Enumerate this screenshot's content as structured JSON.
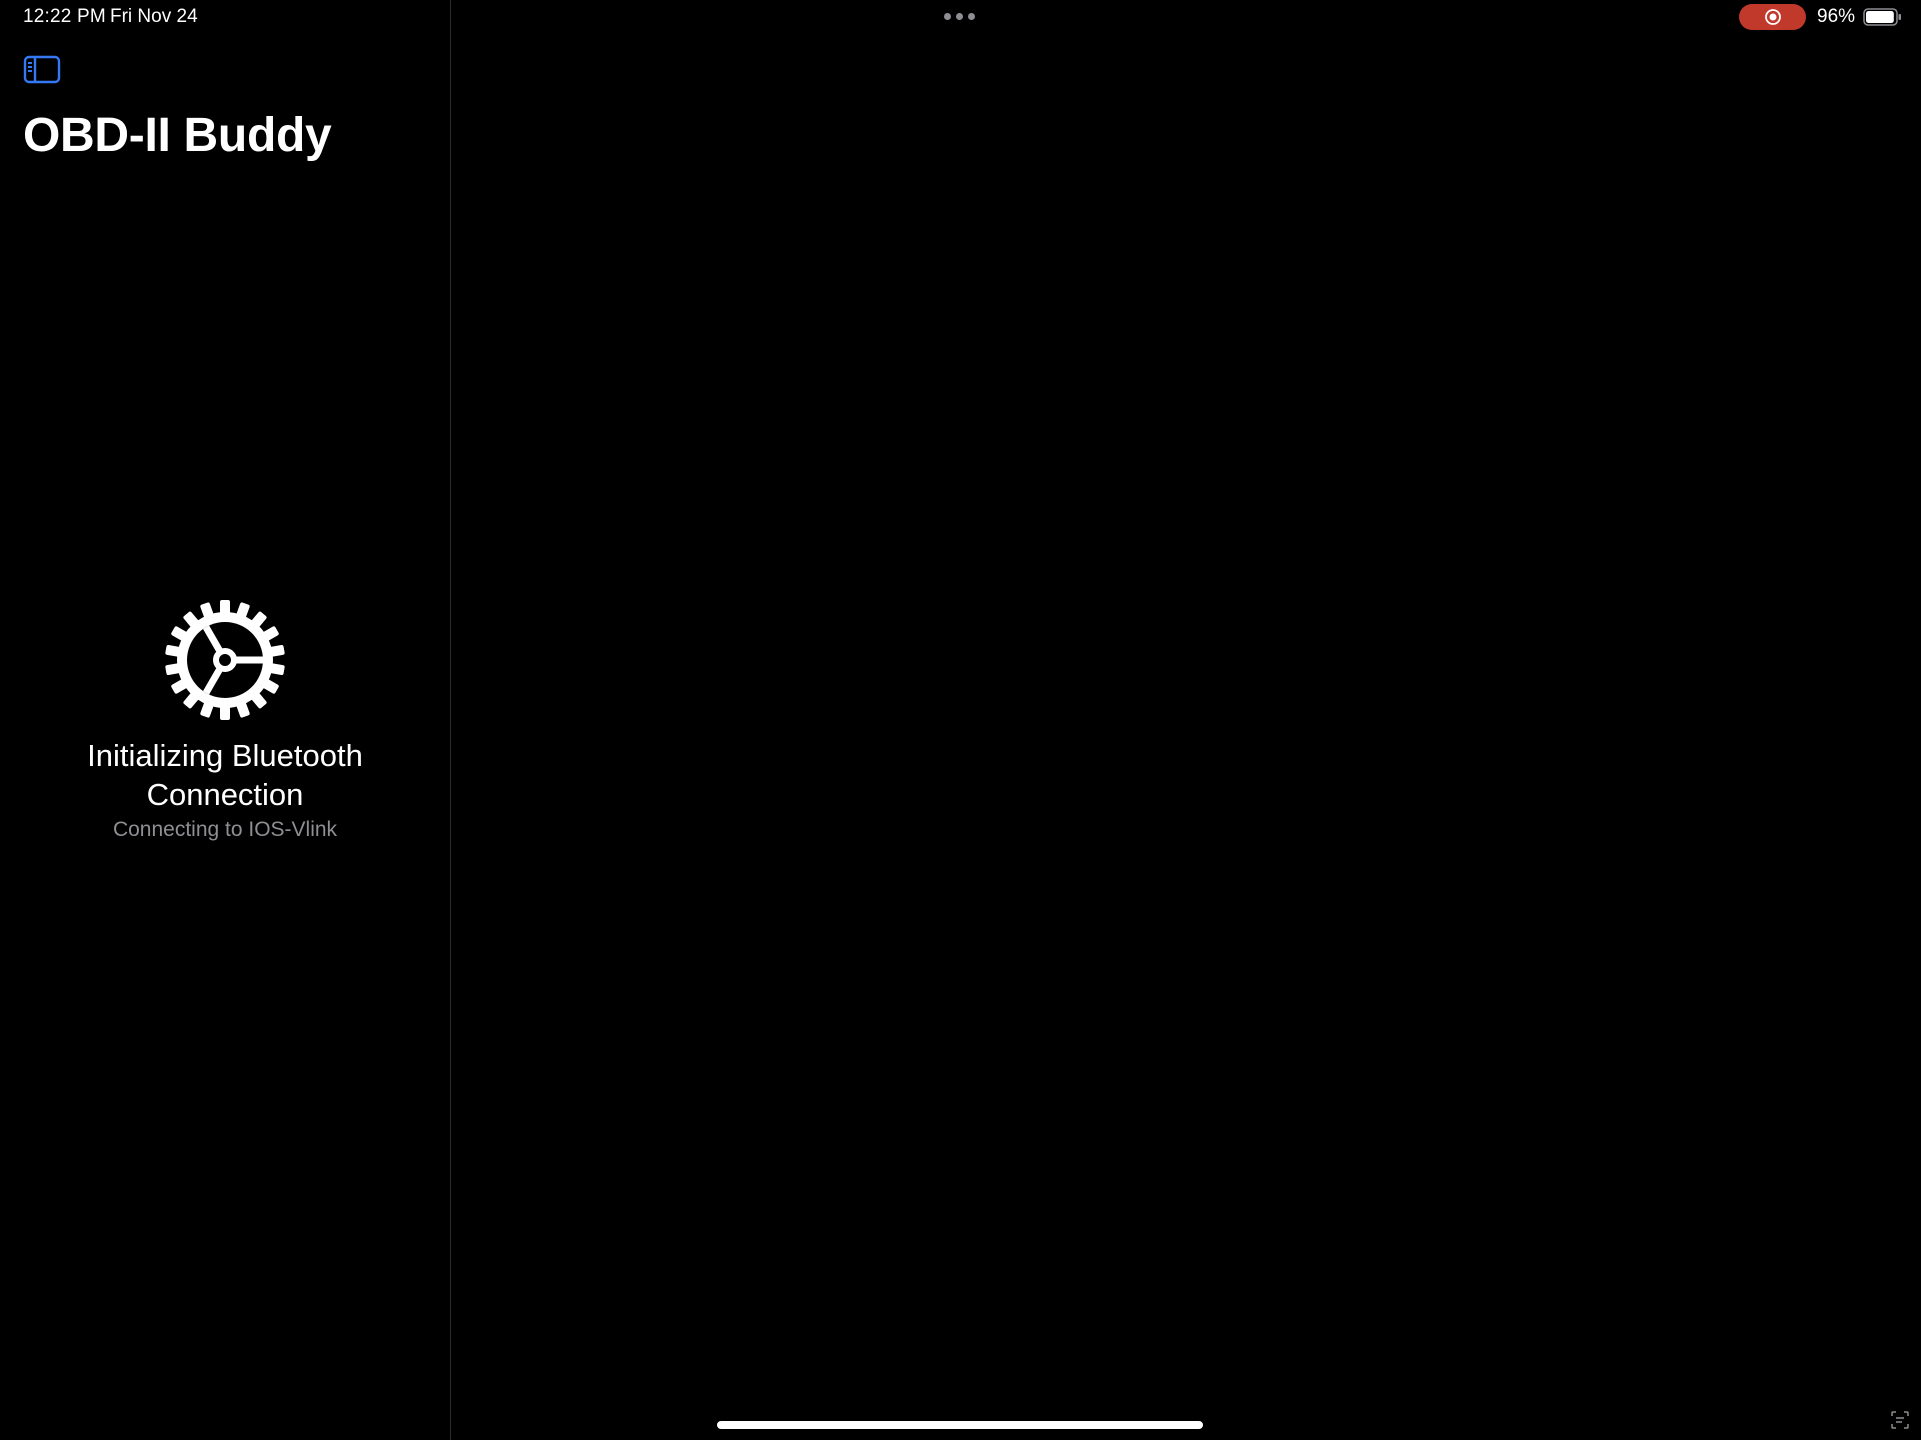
{
  "status_bar": {
    "time": "12:22 PM",
    "date": "Fri Nov 24",
    "battery_percent": "96%",
    "battery_level": 0.96,
    "recording_indicator_color": "#c0392b"
  },
  "sidebar": {
    "toggle_icon": "sidebar-toggle-icon",
    "title": "OBD-II Buddy",
    "loading": {
      "icon": "gear-icon",
      "title": "Initializing Bluetooth Connection",
      "subtitle": "Connecting to IOS-Vlink"
    }
  },
  "colors": {
    "background": "#000000",
    "accent": "#3478f6",
    "secondary_text": "#8e8e93",
    "divider": "#2c2c2e"
  }
}
